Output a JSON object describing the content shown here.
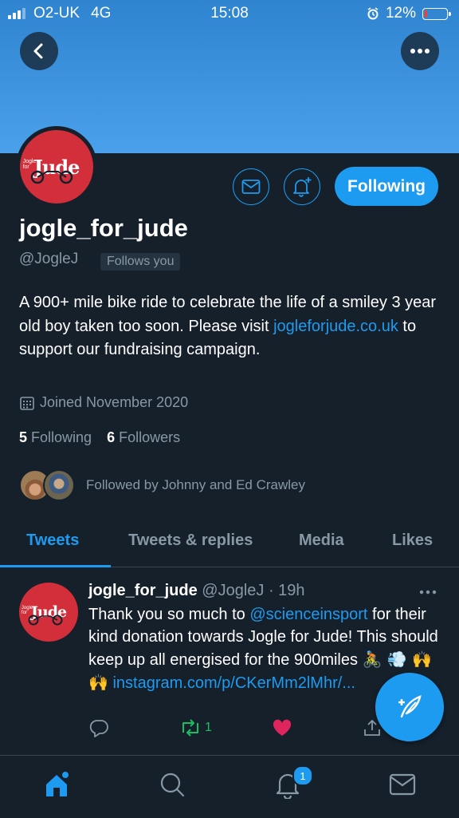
{
  "status_bar": {
    "carrier": "O2-UK",
    "network": "4G",
    "time": "15:08",
    "battery": "12%",
    "battery_level": 0.12,
    "battery_color": "#ff3b30"
  },
  "header": {
    "back_icon": "chevron-left-icon",
    "more_icon": "more-horizontal-icon"
  },
  "profile": {
    "avatar_logo_small": "Jogle for",
    "avatar_logo_main": "Jude",
    "display_name": "jogle_for_jude",
    "handle": "@JogleJ",
    "follows_you": "Follows you",
    "bio_text_before": "A 900+ mile bike ride to celebrate the life of a smiley 3 year old boy taken too soon. Please visit ",
    "bio_link": "jogleforjude.co.uk",
    "bio_text_after": " to support our fundraising campaign.",
    "joined": "Joined November 2020",
    "following_count": "5",
    "following_label": "Following",
    "followers_count": "6",
    "followers_label": "Followers",
    "followed_by": "Followed by Johnny and Ed Crawley",
    "actions": {
      "message_icon": "envelope-icon",
      "notify_icon": "bell-plus-icon",
      "following_label": "Following"
    }
  },
  "tabs": [
    {
      "label": "Tweets",
      "active": true
    },
    {
      "label": "Tweets & replies",
      "active": false
    },
    {
      "label": "Media",
      "active": false
    },
    {
      "label": "Likes",
      "active": false
    }
  ],
  "tweet": {
    "name": "jogle_for_jude",
    "meta": "@JogleJ · 19h",
    "body_before": "Thank you so much to ",
    "mention": "@scienceinsport",
    "body_middle": " for their kind donation towards Jogle for Jude! This should keep up all energised for the 900miles ",
    "emojis": "🚴 💨 🙌🙌",
    "link": "instagram.com/p/CKerMm2lMhr/...",
    "retweet_count": "1",
    "icons": [
      "reply-icon",
      "retweet-icon",
      "heart-icon",
      "share-icon"
    ]
  },
  "fab": {
    "icon": "compose-feather-icon"
  },
  "bottom_nav": {
    "items": [
      "home-icon",
      "search-icon",
      "notifications-icon",
      "messages-icon"
    ],
    "notification_badge": "1"
  },
  "colors": {
    "background": "#15202b",
    "accent": "#1d9bf0",
    "muted": "#8899a6",
    "logo_red": "#d32f3b",
    "retweet_green": "#17bf63",
    "like_red": "#e0245e"
  }
}
